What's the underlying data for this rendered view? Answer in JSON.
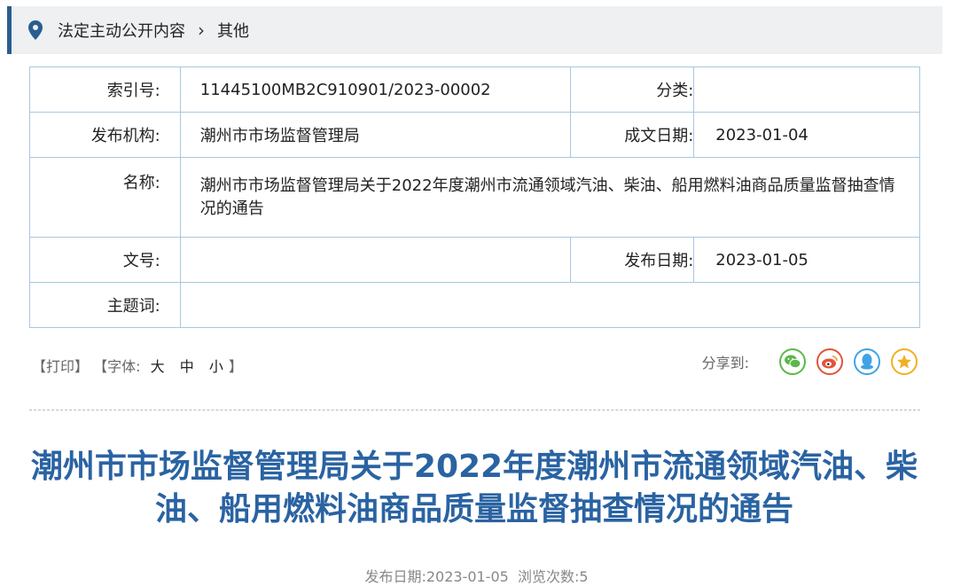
{
  "breadcrumb": {
    "section": "法定主动公开内容",
    "separator": "›",
    "current": "其他"
  },
  "info": {
    "index_label": "索引号:",
    "index_value": "11445100MB2C910901/2023-00002",
    "category_label": "分类:",
    "category_value": "",
    "publisher_label": "发布机构:",
    "publisher_value": "潮州市市场监督管理局",
    "created_label": "成文日期:",
    "created_value": "2023-01-04",
    "name_label": "名称:",
    "name_value": "潮州市市场监督管理局关于2022年度潮州市流通领域汽油、柴油、船用燃料油商品质量监督抽查情况的通告",
    "docno_label": "文号:",
    "docno_value": "",
    "pubdate_label": "发布日期:",
    "pubdate_value": "2023-01-05",
    "keywords_label": "主题词:",
    "keywords_value": ""
  },
  "tools": {
    "print": "【打印】",
    "font_prefix": "【字体:",
    "font_large": "大",
    "font_medium": "中",
    "font_small": "小",
    "font_suffix": "】",
    "share_label": "分享到:"
  },
  "share_icons": [
    {
      "name": "wechat-icon",
      "color": "#5bb84a"
    },
    {
      "name": "weibo-icon",
      "color": "#e2533a"
    },
    {
      "name": "qq-icon",
      "color": "#3fa3e6"
    },
    {
      "name": "qzone-icon",
      "color": "#f2b021"
    }
  ],
  "article": {
    "title": "潮州市市场监督管理局关于2022年度潮州市流通领域汽油、柴油、船用燃料油商品质量监督抽查情况的通告",
    "meta": "发布日期:2023-01-05  浏览次数:5"
  },
  "colors": {
    "accent": "#2a5d8f",
    "title": "#2a63a2",
    "table_border": "#a9c7de"
  }
}
